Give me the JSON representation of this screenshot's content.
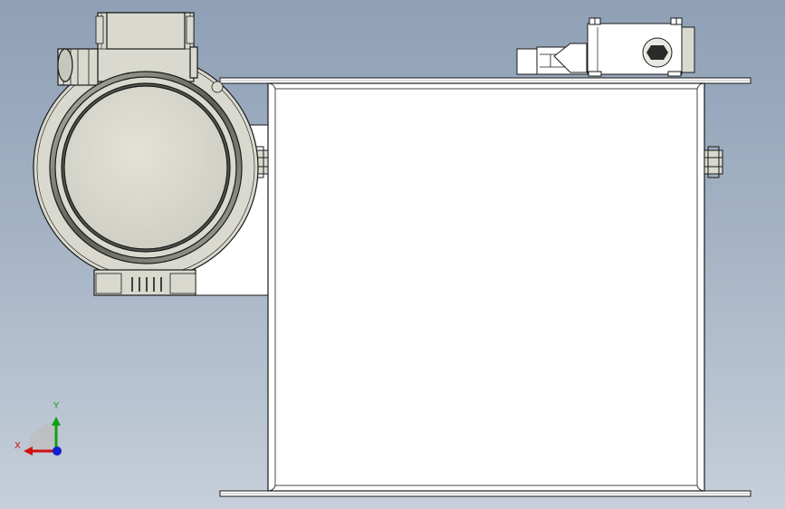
{
  "viewport": {
    "background_top": "#8fa0b6",
    "background_bottom": "#c6cfda",
    "model_fill": "#ffffff",
    "motor_fill": "#d9d9cf",
    "edge_color": "#1a1a1a"
  },
  "triad": {
    "x_label": "X",
    "y_label": "Y",
    "x_color": "#d01010",
    "y_color": "#10a010",
    "z_color": "#1020d0"
  }
}
